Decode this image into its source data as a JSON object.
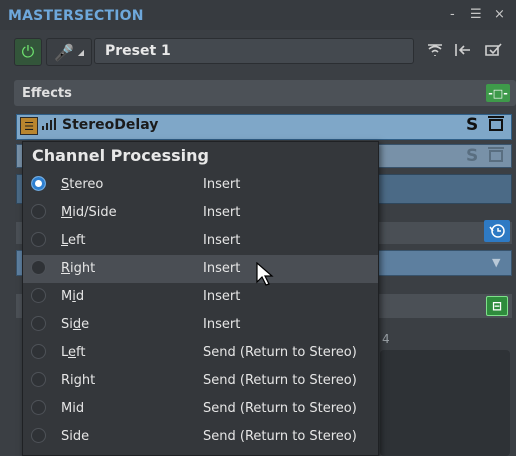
{
  "window": {
    "title": "MASTERSECTION",
    "controls": [
      "-",
      "☰",
      "×"
    ]
  },
  "toolbar": {
    "preset": "Preset 1"
  },
  "effects": {
    "label": "Effects",
    "plugin_name": "StereoDelay",
    "solo": "S"
  },
  "background": {
    "digit": "4"
  },
  "menu": {
    "header": "Channel Processing",
    "items": [
      {
        "label": "Stereo",
        "mnemonic": "S",
        "rest": "tereo",
        "mode": "Insert",
        "selected": true
      },
      {
        "label": "Mid/Side",
        "mnemonic": "M",
        "rest": "id/Side",
        "mode": "Insert",
        "selected": false
      },
      {
        "label": "Left",
        "mnemonic": "L",
        "rest": "eft",
        "mode": "Insert",
        "selected": false
      },
      {
        "label": "Right",
        "mnemonic": "R",
        "rest": "ight",
        "mode": "Insert",
        "selected": false,
        "highlighted": true
      },
      {
        "label": "Mid",
        "mnemonic": "i",
        "pre": "M",
        "rest": "d",
        "mode": "Insert",
        "selected": false
      },
      {
        "label": "Side",
        "mnemonic": "d",
        "pre": "Si",
        "rest": "e",
        "mode": "Insert",
        "selected": false
      },
      {
        "label": "Left",
        "mnemonic": "e",
        "pre": "L",
        "rest": "ft",
        "mode": "Send (Return to Stereo)",
        "selected": false
      },
      {
        "label": "Right",
        "mode": "Send (Return to Stereo)",
        "selected": false
      },
      {
        "label": "Mid",
        "mode": "Send (Return to Stereo)",
        "selected": false
      },
      {
        "label": "Side",
        "mode": "Send (Return to Stereo)",
        "selected": false
      }
    ]
  }
}
